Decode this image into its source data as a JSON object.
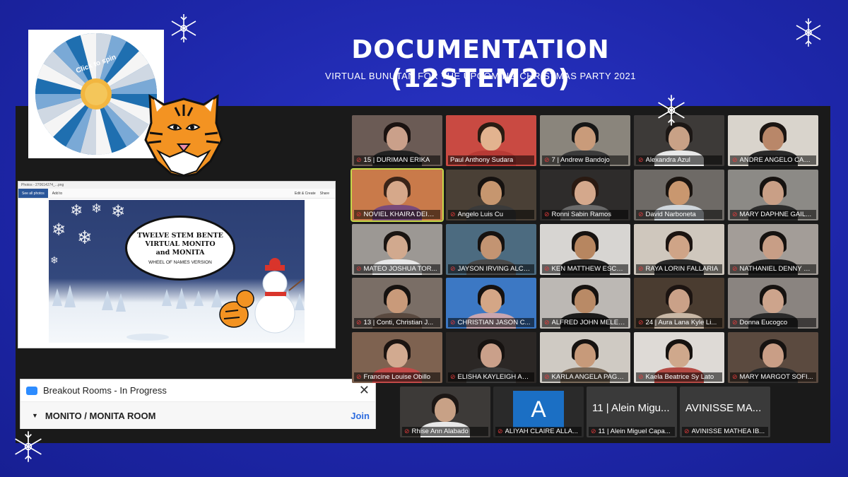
{
  "header": {
    "title": "DOCUMENTATION (12STEM20)",
    "subtitle": "VIRTUAL BUNUTAN FOR THE UPCOMING CHRISTMAS PARTY 2021"
  },
  "wheel": {
    "center_label": "Click to spin"
  },
  "shared_screen": {
    "window_title": "Photos - 270614274_...png",
    "see_all_label": "See all photos",
    "add_label": "Add to",
    "edit_label": "Edit & Create",
    "share_label": "Share",
    "slide_title_line1": "TWELVE STEM BENTE",
    "slide_title_line2": "VIRTUAL MONITO",
    "slide_title_line3": "and MONITA",
    "slide_caption": "WHEEL OF NAMES VERSION"
  },
  "breakout": {
    "title": "Breakout Rooms - In Progress",
    "room_name": "MONITO / MONITA ROOM",
    "join_label": "Join"
  },
  "participants": [
    {
      "name": "15 | DURIMAN ERIKA",
      "muted": true
    },
    {
      "name": "Paul Anthony Sudara",
      "muted": false
    },
    {
      "name": "7 | Andrew Bandojo",
      "muted": true
    },
    {
      "name": "Alexandra Azul",
      "muted": true
    },
    {
      "name": "ANDRE ANGELO CALI...",
      "muted": true
    },
    {
      "name": "NOVIEL KHAIRA DEIG...",
      "muted": true,
      "active": true
    },
    {
      "name": "Angelo Luis Cu",
      "muted": true
    },
    {
      "name": "Ronni Sabin Ramos",
      "muted": true
    },
    {
      "name": "David Narboneta",
      "muted": true
    },
    {
      "name": "MARY DAPHNE GAIL...",
      "muted": true
    },
    {
      "name": "MATEO JOSHUA TOR...",
      "muted": true
    },
    {
      "name": "JAYSON IRVING ALCA...",
      "muted": true
    },
    {
      "name": "KEN MATTHEW ESCA...",
      "muted": true
    },
    {
      "name": "RAYA LORIN FALLARIA",
      "muted": true
    },
    {
      "name": "NATHANIEL DENNY G...",
      "muted": true
    },
    {
      "name": "13 | Conti, Christian J...",
      "muted": true
    },
    {
      "name": "CHRISTIAN JASON C...",
      "muted": true
    },
    {
      "name": "ALFRED JOHN MELEG...",
      "muted": true
    },
    {
      "name": "24 | Aura Lana Kyle Li...",
      "muted": true
    },
    {
      "name": "Donna Eucogco",
      "muted": true
    },
    {
      "name": "Francine Louise Obillo",
      "muted": true
    },
    {
      "name": "ELISHA KAYLEIGH ALI...",
      "muted": true
    },
    {
      "name": "KARLA ANGELA PAGK...",
      "muted": true
    },
    {
      "name": "Kaela Beatrice Sy Lato",
      "muted": true
    },
    {
      "name": "MARY MARGOT SOFI...",
      "muted": true
    }
  ],
  "bottom_row": [
    {
      "name": "Rhise Ann Alabado",
      "muted": true
    },
    {
      "name": "ALIYAH CLAIRE ALLA...",
      "muted": true,
      "initial": "A"
    },
    {
      "name": "11 | Alein Miguel Capa...",
      "muted": true,
      "big_name": "11 | Alein Migu..."
    },
    {
      "name": "AVINISSE MATHEA IB...",
      "muted": true,
      "big_name": "AVINISSE MA..."
    }
  ],
  "colors": {
    "background": "#1f2ab0",
    "gallery": "#1a1a1a",
    "active_outline": "#c6d84a",
    "muted_icon": "#e63b3b",
    "avatar_blue": "#1b6fc4"
  }
}
